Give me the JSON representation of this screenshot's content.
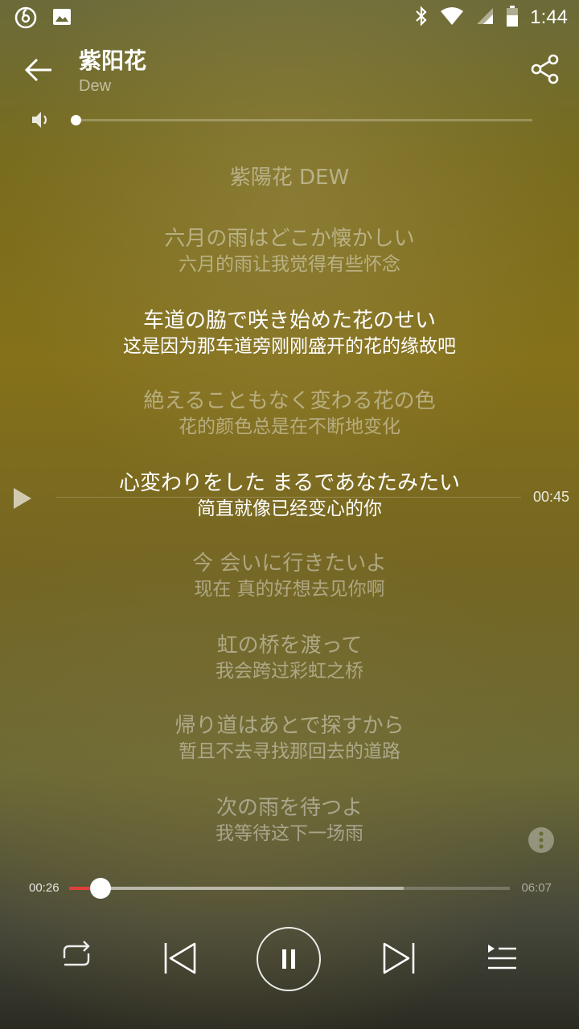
{
  "status": {
    "time": "1:44",
    "icons": [
      "netease-music-icon",
      "image-icon",
      "bluetooth-icon",
      "wifi-icon",
      "signal-icon",
      "battery-icon"
    ]
  },
  "header": {
    "title": "紫阳花",
    "artist": "Dew",
    "back_icon": "arrow-left-icon",
    "share_icon": "share-icon"
  },
  "volume": {
    "icon": "volume-icon",
    "level": 0
  },
  "lyrics": [
    {
      "ja": "紫陽花  DEW",
      "zh": ""
    },
    {
      "ja": "六月の雨はどこか懐かしい",
      "zh": "六月的雨让我觉得有些怀念"
    },
    {
      "ja": "车道の脇で咲き始めた花のせい",
      "zh": "这是因为那车道旁刚刚盛开的花的缘故吧",
      "current": true
    },
    {
      "ja": "絶えることもなく変わる花の色",
      "zh": "花的颜色总是在不断地变化"
    },
    {
      "ja": "心変わりをした まるであなたみたい",
      "zh": "简直就像已经变心的你",
      "guide": true
    },
    {
      "ja": "今 会いに行きたいよ",
      "zh": "现在 真的好想去见你啊"
    },
    {
      "ja": "虹の桥を渡って",
      "zh": "我会跨过彩虹之桥"
    },
    {
      "ja": "帰り道はあとで探すから",
      "zh": "暂且不去寻找那回去的道路"
    },
    {
      "ja": "次の雨を待つよ",
      "zh": "我等待这下一场雨"
    }
  ],
  "seek_guide": {
    "time": "00:45",
    "play_icon": "play-icon"
  },
  "more_icon": "more-vertical-icon",
  "progress": {
    "elapsed": "00:26",
    "total": "06:07",
    "played_fraction": 0.071,
    "buffered_fraction": 0.76
  },
  "controls": {
    "repeat_icon": "repeat-icon",
    "prev_icon": "skip-previous-icon",
    "pause_icon": "pause-icon",
    "next_icon": "skip-next-icon",
    "playlist_icon": "playlist-icon"
  },
  "colors": {
    "accent": "#e0403a",
    "current_lyric": "#ffffff",
    "dim_lyric": "rgba(255,255,255,0.42)"
  }
}
